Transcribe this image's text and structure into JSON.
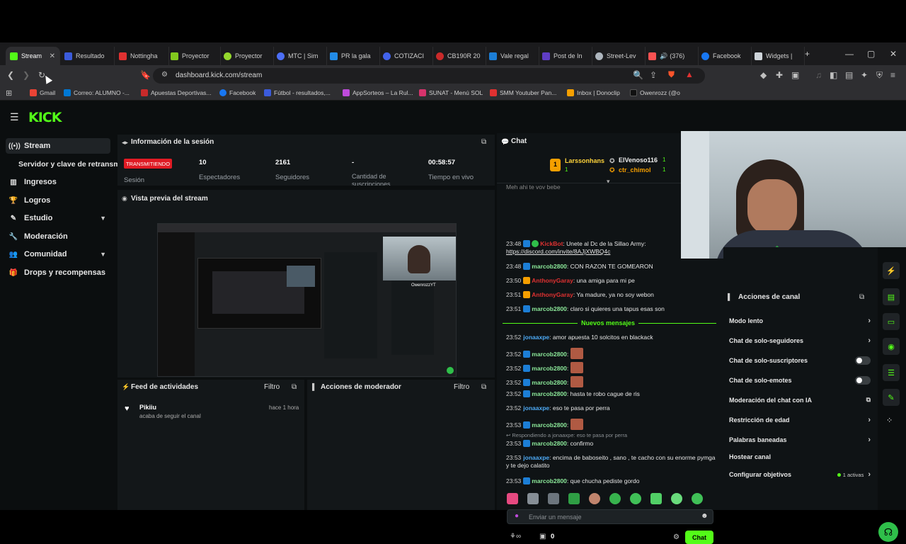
{
  "browser": {
    "tabs": [
      {
        "label": "Stream",
        "color": "#53fc18"
      },
      {
        "label": "Resultado",
        "color": "#3b5bdb"
      },
      {
        "label": "Nottingha",
        "color": "#e03131"
      },
      {
        "label": "Proyector",
        "color": "#82c91e"
      },
      {
        "label": "Proyector",
        "color": "#94d82d"
      },
      {
        "label": "MTC | Sim",
        "color": "#4c6ef5"
      },
      {
        "label": "PR la gala",
        "color": "#228be6"
      },
      {
        "label": "COTIZACI",
        "color": "#4263eb"
      },
      {
        "label": "CB190R 20",
        "color": "#c92a2a"
      },
      {
        "label": "Vale regal",
        "color": "#1c7ed6"
      },
      {
        "label": "Post de In",
        "color": "#5f3dc4"
      },
      {
        "label": "Street-Lev",
        "color": "#adb5bd"
      },
      {
        "label": "(376)",
        "color": "#fa5252"
      },
      {
        "label": "Facebook",
        "color": "#1877f2"
      },
      {
        "label": "Widgets |",
        "color": "#ced4da"
      }
    ],
    "url": "dashboard.kick.com/stream",
    "bookmarks": [
      {
        "label": "Gmail",
        "color": "#ea4335"
      },
      {
        "label": "Correo: ALUMNO -...",
        "color": "#0078d4"
      },
      {
        "label": "Apuestas Deportivas...",
        "color": "#c92a2a"
      },
      {
        "label": "Facebook",
        "color": "#1877f2"
      },
      {
        "label": "Fútbol - resultados,...",
        "color": "#3b5bdb"
      },
      {
        "label": "AppSorteos – La Rul...",
        "color": "#be4bdb"
      },
      {
        "label": "SUNAT - Menú SOL",
        "color": "#d6336c"
      },
      {
        "label": "SMM Youtuber Pan...",
        "color": "#e03131"
      },
      {
        "label": "Inbox | Donoclip",
        "color": "#f59f00"
      },
      {
        "label": "Owenrozz (@o",
        "color": "#111111"
      }
    ]
  },
  "kick": {
    "logo": "KICK",
    "accent": "#53fc18"
  },
  "sidebar": {
    "items": [
      {
        "label": "Stream",
        "icon": "broadcast-icon"
      },
      {
        "label": "Servidor y clave de retransm",
        "icon": ""
      },
      {
        "label": "Ingresos",
        "icon": "bar-chart-icon"
      },
      {
        "label": "Logros",
        "icon": "trophy-icon"
      },
      {
        "label": "Estudio",
        "icon": "brush-icon"
      },
      {
        "label": "Moderación",
        "icon": "wrench-icon"
      },
      {
        "label": "Comunidad",
        "icon": "people-icon"
      },
      {
        "label": "Drops y recompensas",
        "icon": "gift-icon"
      }
    ]
  },
  "session": {
    "title": "Información de la sesión",
    "status": "TRANSMITIENDO",
    "status_label": "Sesión",
    "viewers": "10",
    "viewers_label": "Espectadores",
    "followers": "2161",
    "followers_label": "Seguidores",
    "subs": "-",
    "subs_label": "Cantidad de suscripciones",
    "time": "00:58:57",
    "time_label": "Tiempo en vivo"
  },
  "preview": {
    "title": "Vista previa del stream"
  },
  "feed": {
    "title": "Feed de actividades",
    "filter": "Filtro",
    "item_user": "Pikiiu",
    "item_text": "acaba de seguir el canal",
    "item_time": "hace 1 hora"
  },
  "modactions": {
    "title": "Acciones de moderador",
    "filter": "Filtro"
  },
  "chat": {
    "title": "Chat",
    "top1": "Larssonhans",
    "top1_count": "1",
    "top2": "ElVenoso116",
    "top2_count": "1",
    "top3": "ctr_chimol",
    "top3_count": "1",
    "new_messages": "Nuevos mensajes",
    "reply_hint": "Respondiendo a jonaaxpe: eso te pasa por perra",
    "input_placeholder": "Enviar un mensaje",
    "send_label": "Chat",
    "count_label": "0",
    "messages": [
      {
        "time": "23:48",
        "user": "KickBot",
        "color": "#e03131",
        "text": ": Unete al Dc de la Sillao Army:",
        "link": "https://discord.com/invite/8AJjXWBQ4c"
      },
      {
        "time": "23:48",
        "user": "marcob2800",
        "color": "#8ce99a",
        "text": ": CON RAZON TE GOMEARON"
      },
      {
        "time": "23:50",
        "user": "AnthonyGaray",
        "color": "#e03131",
        "text": ": una amiga para mi pe"
      },
      {
        "time": "23:51",
        "user": "AnthonyGaray",
        "color": "#e03131",
        "text": ": Ya madure, ya no soy webon"
      },
      {
        "time": "23:51",
        "user": "marcob2800",
        "color": "#8ce99a",
        "text": ": claro si quieres una tapus esas son"
      },
      {
        "time": "23:52",
        "user": "jonaaxpe",
        "color": "#4dabf7",
        "text": ": amor apuesta 10 solcitos en blackack"
      },
      {
        "time": "23:52",
        "user": "marcob2800",
        "color": "#8ce99a",
        "text": ":",
        "emote": true
      },
      {
        "time": "23:52",
        "user": "marcob2800",
        "color": "#8ce99a",
        "text": ":",
        "emote": true
      },
      {
        "time": "23:52",
        "user": "marcob2800",
        "color": "#8ce99a",
        "text": ":",
        "emote": true
      },
      {
        "time": "23:52",
        "user": "marcob2800",
        "color": "#8ce99a",
        "text": ": hasta te robo cague de ris"
      },
      {
        "time": "23:52",
        "user": "jonaaxpe",
        "color": "#4dabf7",
        "text": ": eso te pasa por perra"
      },
      {
        "time": "23:53",
        "user": "marcob2800",
        "color": "#8ce99a",
        "text": ":",
        "emote": true
      },
      {
        "time": "23:53",
        "user": "marcob2800",
        "color": "#8ce99a",
        "text": ": confirmo"
      },
      {
        "time": "23:53",
        "user": "jonaaxpe",
        "color": "#4dabf7",
        "text": ": encima de baboseito , sano , te cacho con su enorme pymga y te dejo calatito"
      },
      {
        "time": "23:53",
        "user": "marcob2800",
        "color": "#8ce99a",
        "text": ": que chucha pediste gordo"
      }
    ],
    "top_partial": "Meh ahi te voy bebe"
  },
  "channel_actions": {
    "title": "Acciones de canal",
    "items": [
      {
        "label": "Modo lento",
        "kind": "chevron"
      },
      {
        "label": "Chat de solo-seguidores",
        "kind": "chevron"
      },
      {
        "label": "Chat de solo-suscriptores",
        "kind": "toggle"
      },
      {
        "label": "Chat de solo-emotes",
        "kind": "toggle"
      },
      {
        "label": "Moderación del chat con IA",
        "kind": "external"
      },
      {
        "label": "Restricción de edad",
        "kind": "chevron"
      },
      {
        "label": "Palabras baneadas",
        "kind": "chevron"
      },
      {
        "label": "Hostear canal",
        "kind": "none"
      },
      {
        "label": "Configurar objetivos",
        "kind": "chevron",
        "badge": "1 activas"
      }
    ]
  },
  "webcam": {
    "overlay_name": "OwenrozzYT"
  }
}
